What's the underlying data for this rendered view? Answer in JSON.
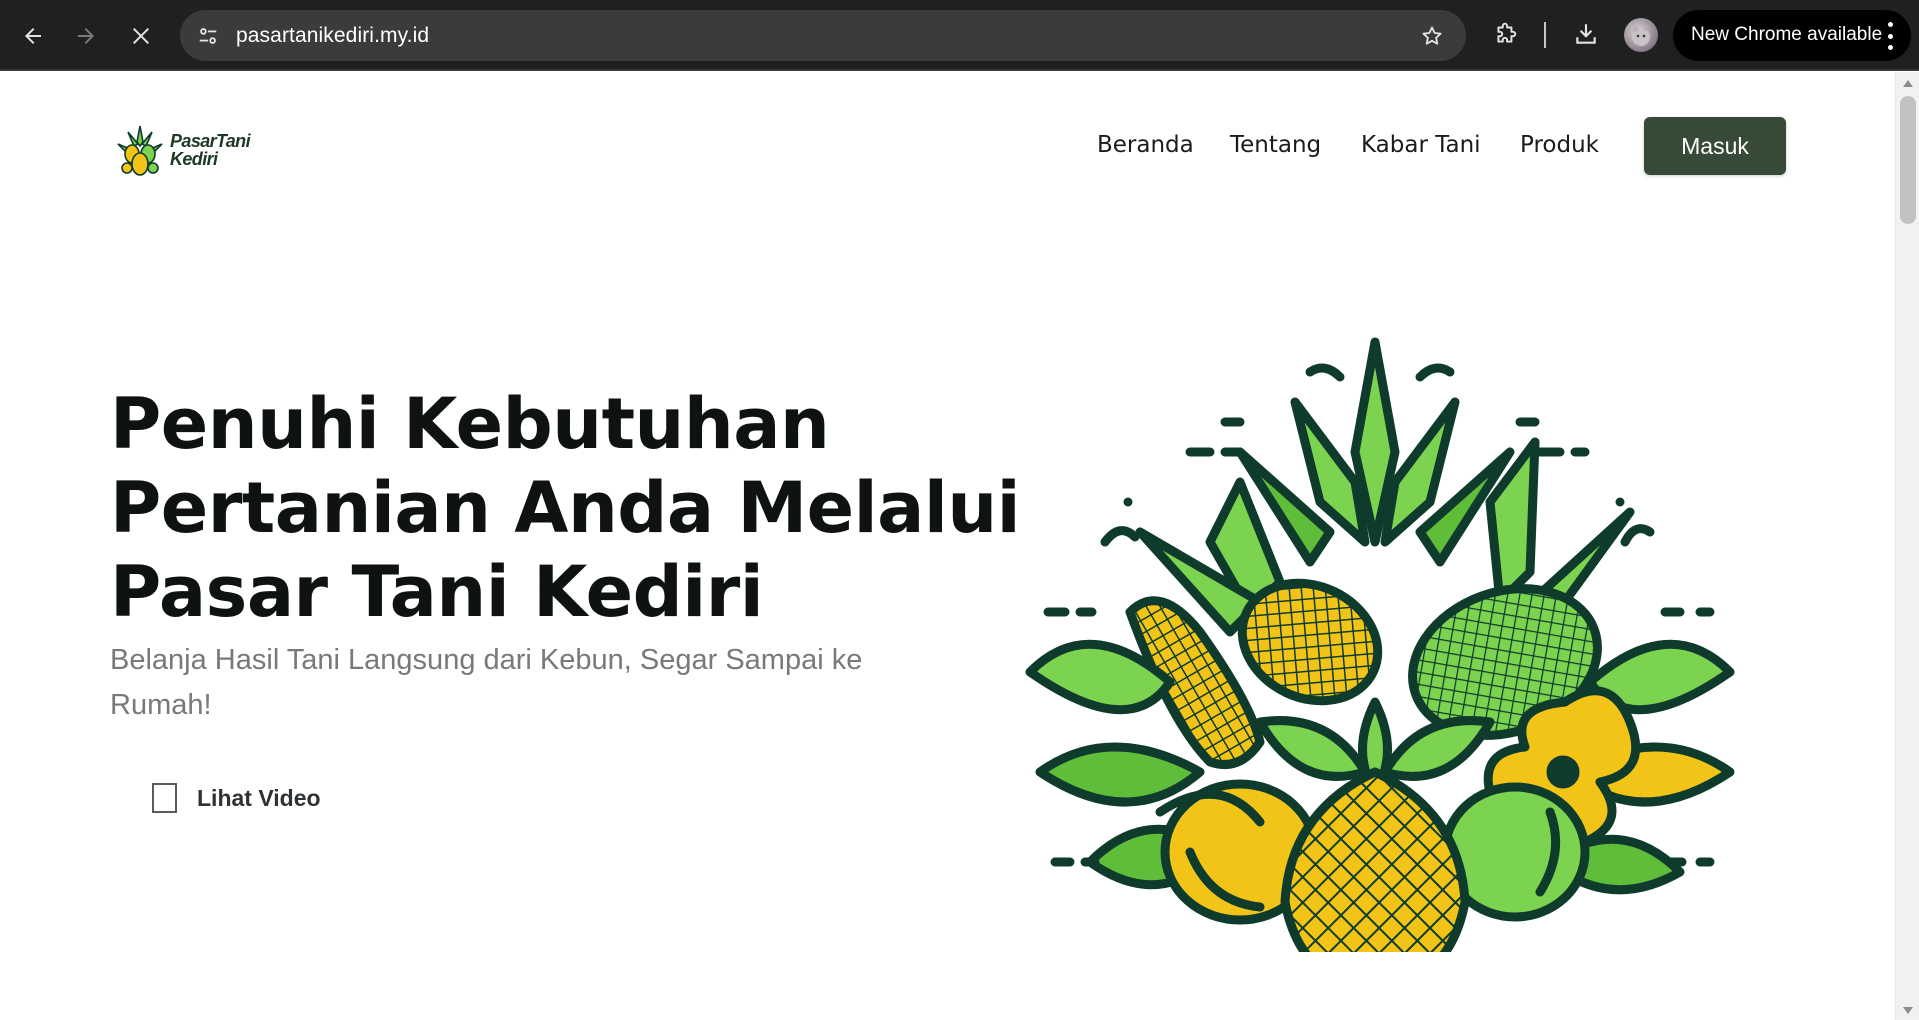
{
  "browser": {
    "url": "pasartanikediri.my.id",
    "update_label": "New Chrome available",
    "icons": [
      "back-icon",
      "forward-icon",
      "stop-loading-icon",
      "site-info-icon",
      "bookmark-star-icon",
      "extensions-icon",
      "download-icon",
      "profile-avatar",
      "more-vert-icon"
    ]
  },
  "site": {
    "logo": {
      "line1": "PasarTani",
      "line2": "Kediri"
    },
    "nav": {
      "items": [
        {
          "label": "Beranda"
        },
        {
          "label": "Tentang"
        },
        {
          "label": "Kabar Tani"
        },
        {
          "label": "Produk"
        }
      ],
      "login_label": "Masuk"
    },
    "hero": {
      "title_lines": [
        "Penuhi Kebutuhan",
        "Pertanian Anda Melalui",
        "Pasar Tani Kediri"
      ],
      "subtitle": "Belanja Hasil Tani Langsung dari Kebun, Segar Sampai ke Rumah!",
      "video_label": "Lihat Video"
    }
  },
  "colors": {
    "chrome_bg": "#1f2020",
    "omnibox_bg": "#3a3b3c",
    "brand_green": "#364a37",
    "title_text": "#0f1213",
    "subtitle_text": "#77797b",
    "art_dark": "#0e3b2c",
    "art_green": "#7bd34f",
    "art_yellow": "#f2c418"
  }
}
